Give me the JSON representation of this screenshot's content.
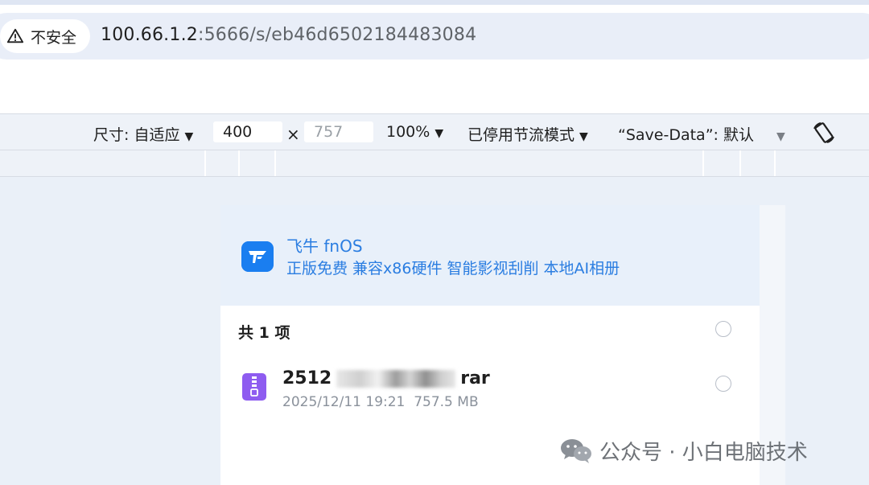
{
  "browser": {
    "security_label": "不安全",
    "url_host": "100.66.1.2",
    "url_rest": ":5666/s/eb46d6502184483084"
  },
  "devtools": {
    "dimensions_label": "尺寸: 自适应",
    "width_value": "400",
    "times_symbol": "×",
    "height_placeholder": "757",
    "zoom": "100%",
    "throttling": "已停用节流模式",
    "save_data": "“Save-Data”: 默认"
  },
  "page": {
    "banner_title": "飞牛 fnOS",
    "banner_subtitle": "正版免费 兼容x86硬件 智能影视刮削 本地AI相册",
    "count_label": "共 1 项",
    "file": {
      "name_prefix": "2512",
      "name_suffix": "rar",
      "date": "2025/12/11 19:21",
      "size": "757.5 MB"
    }
  },
  "watermark": {
    "text": "公众号 · 小白电脑技术"
  },
  "colors": {
    "accent": "#2a7de1",
    "zip_icon": "#8e5cf0"
  }
}
